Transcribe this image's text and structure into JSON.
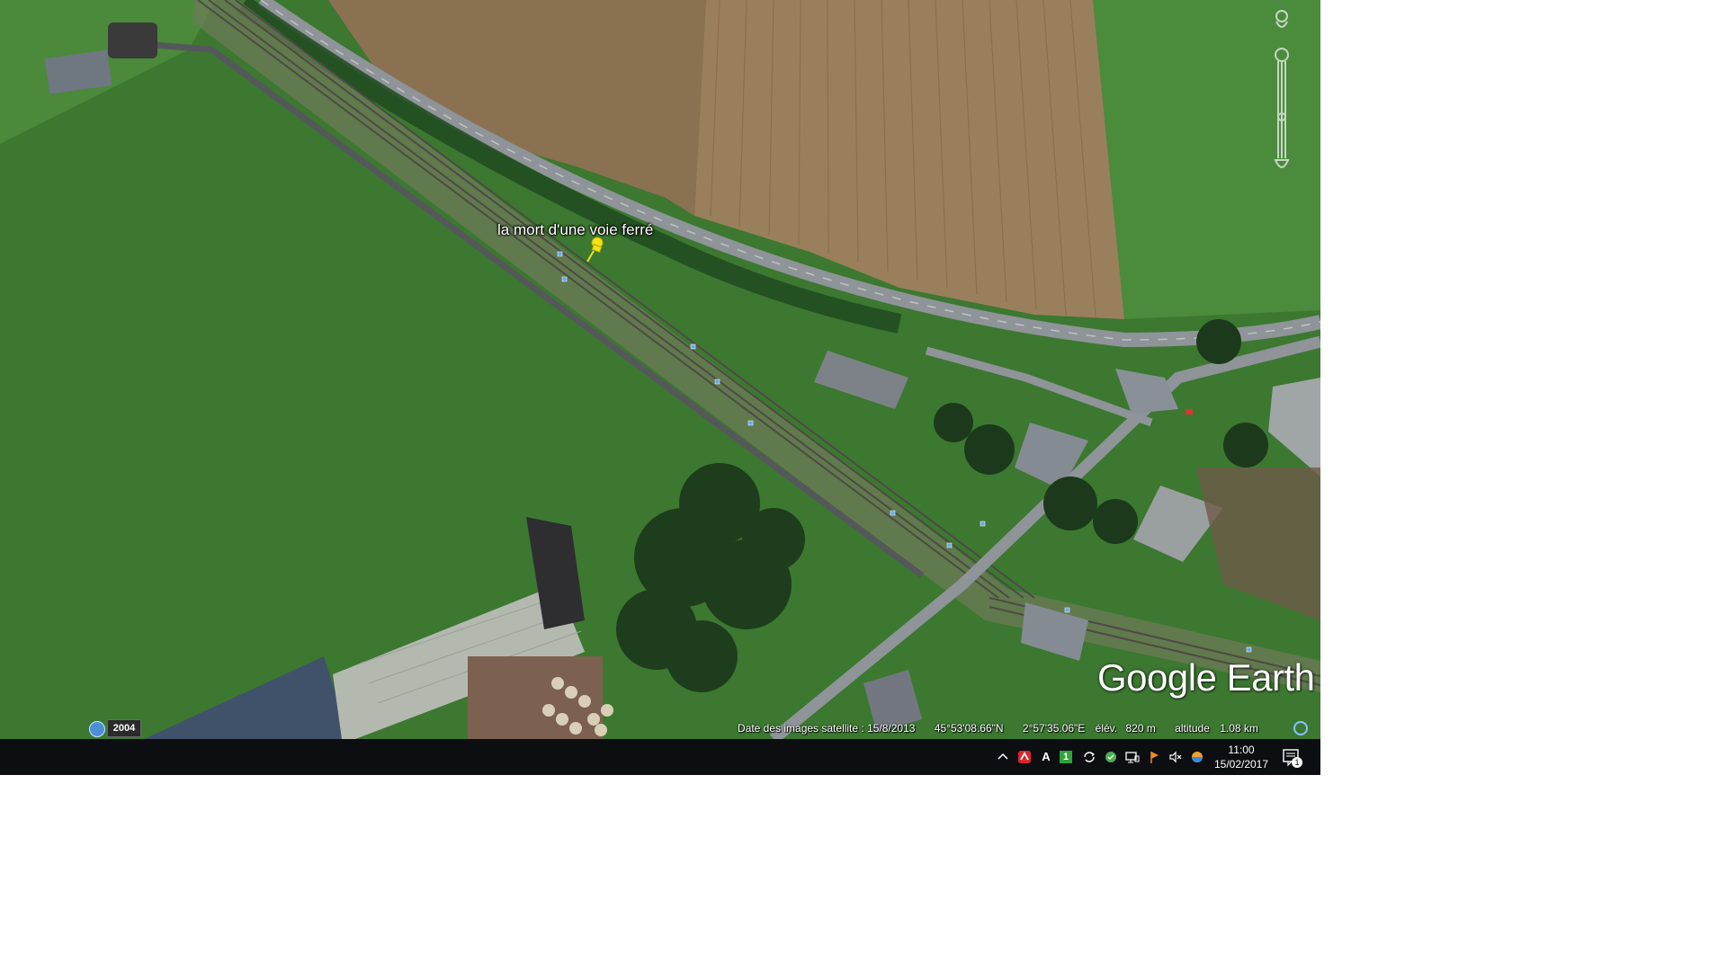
{
  "placemark": {
    "label": "la mort d'une voie ferré",
    "pin_color": "#f2e21a"
  },
  "branding": {
    "logo_text": "Google Earth"
  },
  "historical_imagery": {
    "icon": "clock-history-icon",
    "year": "2004"
  },
  "status_bar": {
    "imagery_date": "Date des images satellite : 15/8/2013",
    "latitude": "45°53'08.66\"N",
    "longitude": "2°57'35.06\"E",
    "elevation_label": "élév.",
    "elevation_value": "820 m",
    "altitude_label": "altitude",
    "altitude_value": "1.08 km"
  },
  "taskbar": {
    "tray_icons": [
      "chevron-up-icon",
      "avira-umbrella-icon",
      "font-a-icon",
      "green-number-one-icon",
      "sync-arrows-icon",
      "green-update-icon",
      "network-monitor-icon",
      "orange-flag-icon",
      "speaker-muted-icon",
      "color-ball-icon"
    ],
    "font_icon_text": "A",
    "number_icon_text": "1",
    "mute_icon_text": "🔇",
    "time": "11:00",
    "date": "15/02/2017",
    "notification_count": "1"
  },
  "colors": {
    "grass": "#3f7a32",
    "field_brown": "#8a7152",
    "road": "#8f9498",
    "taskbar": "#0c0e12"
  }
}
